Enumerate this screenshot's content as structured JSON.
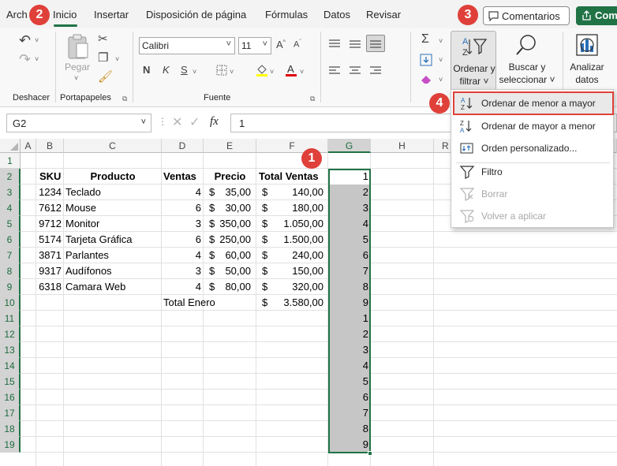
{
  "menu": {
    "tabs": [
      "Arch",
      "Inicio",
      "Insertar",
      "Disposición de página",
      "Fórmulas",
      "Datos",
      "Revisar"
    ],
    "comentarios": "Comentarios",
    "compartir": "Com"
  },
  "ribbon": {
    "groups": {
      "deshacer": "Deshacer",
      "portapapeles": "Portapapeles",
      "fuente": "Fuente"
    },
    "pegar": "Pegar",
    "font_name": "Calibri",
    "font_size": "11",
    "bold": "N",
    "italic": "K",
    "underline": "S",
    "ordenar": [
      "Ordenar y",
      "filtrar ˅"
    ],
    "buscar": [
      "Buscar y",
      "seleccionar ˅"
    ],
    "analizar": [
      "Analizar",
      "datos"
    ]
  },
  "formula_bar": {
    "name_box": "G2",
    "fx": "fx",
    "value": "1"
  },
  "grid": {
    "columns": [
      "A",
      "B",
      "C",
      "D",
      "E",
      "F",
      "G",
      "H",
      "R"
    ],
    "rows": [
      "1",
      "2",
      "3",
      "4",
      "5",
      "6",
      "7",
      "8",
      "9",
      "10",
      "11",
      "12",
      "13",
      "14",
      "15",
      "16",
      "17",
      "18",
      "19"
    ],
    "headers": {
      "sku": "SKU",
      "producto": "Producto",
      "ventas": "Ventas",
      "precio": "Precio",
      "total": "Total Ventas"
    },
    "data": [
      {
        "sku": "1234",
        "producto": "Teclado",
        "ventas": "4",
        "precio": "35,00",
        "total": "140,00"
      },
      {
        "sku": "7612",
        "producto": "Mouse",
        "ventas": "6",
        "precio": "30,00",
        "total": "180,00"
      },
      {
        "sku": "9712",
        "producto": "Monitor",
        "ventas": "3",
        "precio": "350,00",
        "total": "1.050,00"
      },
      {
        "sku": "5174",
        "producto": "Tarjeta Gráfica",
        "ventas": "6",
        "precio": "250,00",
        "total": "1.500,00"
      },
      {
        "sku": "3871",
        "producto": "Parlantes",
        "ventas": "4",
        "precio": "60,00",
        "total": "240,00"
      },
      {
        "sku": "9317",
        "producto": "Audífonos",
        "ventas": "3",
        "precio": "50,00",
        "total": "150,00"
      },
      {
        "sku": "6318",
        "producto": "Camara Web",
        "ventas": "4",
        "precio": "80,00",
        "total": "320,00"
      }
    ],
    "currency": "$",
    "total_label": "Total Enero",
    "total_value": "3.580,00",
    "g_values": [
      "1",
      "2",
      "3",
      "4",
      "5",
      "6",
      "7",
      "8",
      "9",
      "1",
      "2",
      "3",
      "4",
      "5",
      "6",
      "7",
      "8",
      "9"
    ]
  },
  "sort_menu": {
    "items": [
      {
        "label": "Ordenar de menor a mayor",
        "enabled": true
      },
      {
        "label": "Ordenar de mayor a menor",
        "enabled": true
      },
      {
        "label": "Orden personalizado...",
        "enabled": true
      },
      {
        "label": "Filtro",
        "enabled": true
      },
      {
        "label": "Borrar",
        "enabled": false
      },
      {
        "label": "Volver a aplicar",
        "enabled": false
      }
    ]
  },
  "callouts": [
    "1",
    "2",
    "3",
    "4"
  ],
  "colors": {
    "accent": "#217346",
    "callout": "#e0403a",
    "selection": "#c6c6c6"
  }
}
